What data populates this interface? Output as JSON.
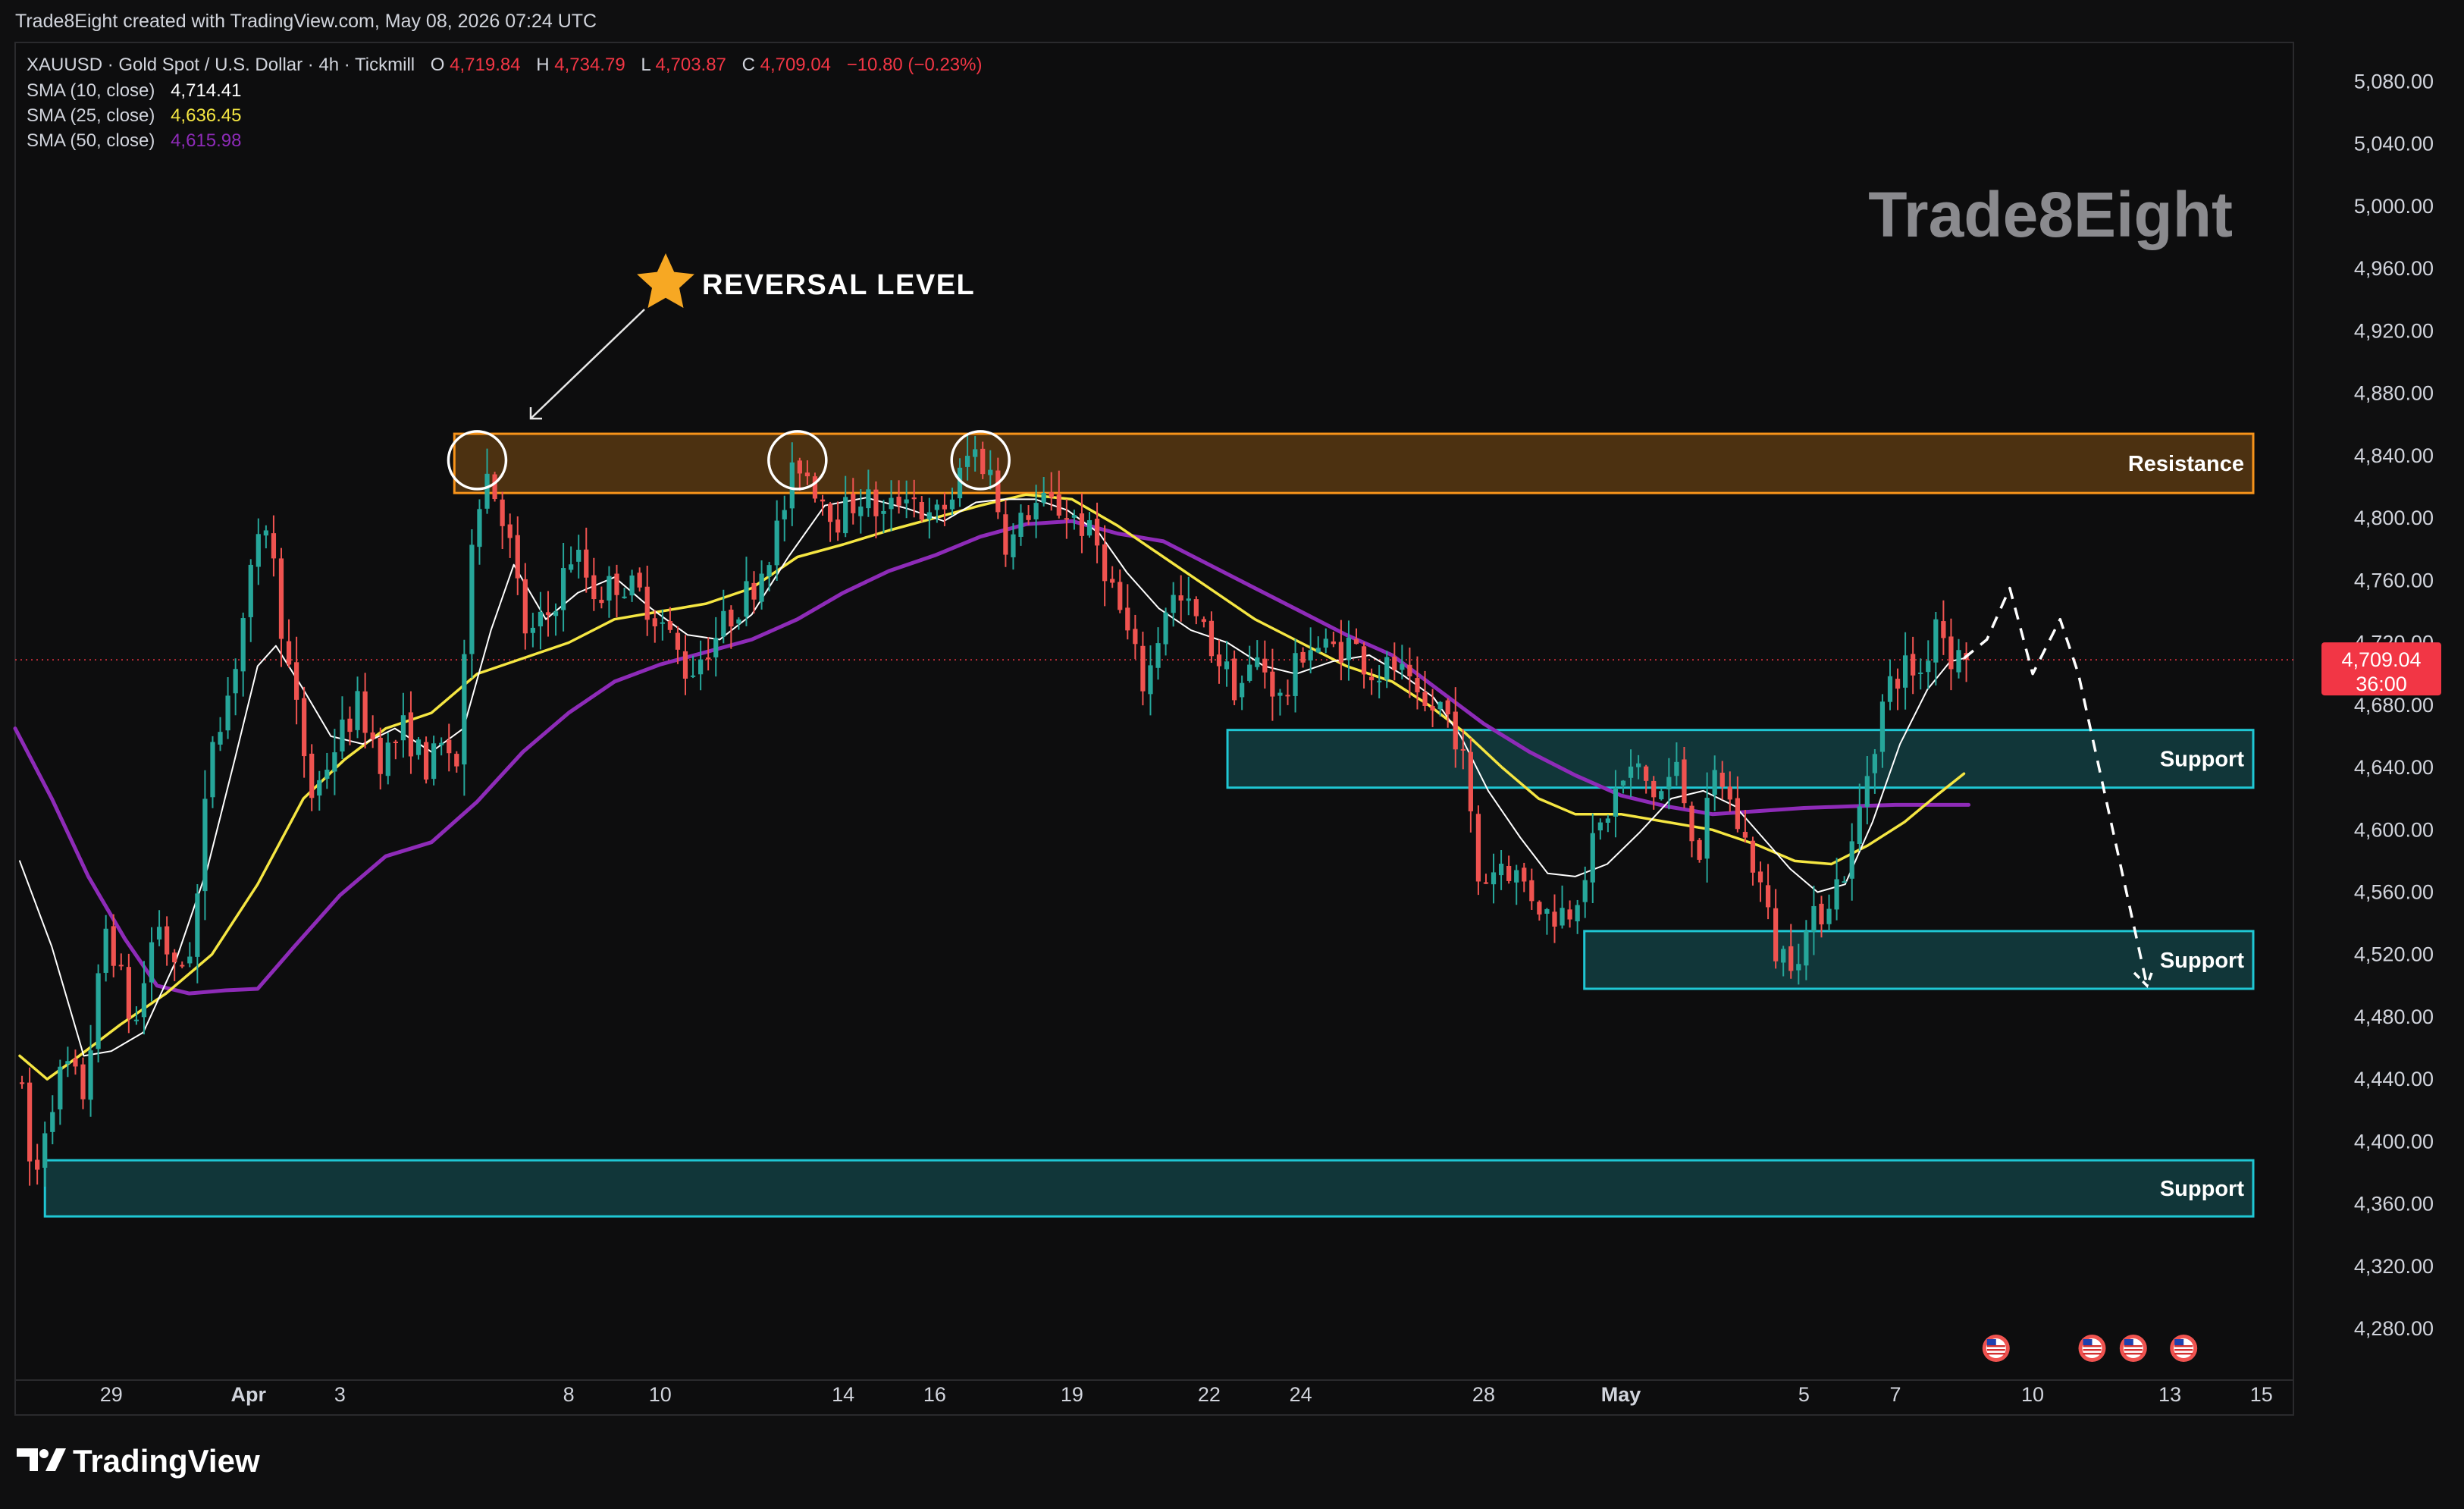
{
  "header": {
    "created_text": "Trade8Eight created with TradingView.com, May 08, 2026 07:24 UTC"
  },
  "legend": {
    "symbol_line": "XAUUSD · Gold Spot / U.S. Dollar · 4h · Tickmill",
    "ohlc": {
      "o_label": "O",
      "o_value": "4,719.84",
      "h_label": "H",
      "h_value": "4,734.79",
      "l_label": "L",
      "l_value": "4,703.87",
      "c_label": "C",
      "c_value": "4,709.04",
      "change": "−10.80 (−0.23%)"
    },
    "indicators": [
      {
        "label": "SMA (10, close)",
        "value": "4,714.41",
        "color": "#ffffff"
      },
      {
        "label": "SMA (25, close)",
        "value": "4,636.45",
        "color": "#f5e642"
      },
      {
        "label": "SMA (50, close)",
        "value": "4,615.98",
        "color": "#8e2bb8"
      }
    ]
  },
  "watermark": "Trade8Eight",
  "annotation": {
    "text": "REVERSAL LEVEL",
    "star_icon": "star-icon"
  },
  "zones": [
    {
      "label": "Resistance",
      "low": 4816,
      "high": 4854,
      "x_start": 7.5,
      "color": "#f7931a"
    },
    {
      "label": "Support",
      "low": 4627,
      "high": 4664,
      "x_start": 24.4,
      "color": "#1fc7d4"
    },
    {
      "label": "Support",
      "low": 4498,
      "high": 4535,
      "x_start": 32.2,
      "color": "#1fc7d4"
    },
    {
      "label": "Support",
      "low": 4352,
      "high": 4388,
      "x_start": -1.45,
      "color": "#1fc7d4"
    }
  ],
  "price_badge": {
    "price": "4,709.04",
    "countdown": "36:00",
    "value": 4709.04,
    "color": "#f23645"
  },
  "branding": {
    "logo_text": "TradingView"
  },
  "chart_data": {
    "type": "candlestick",
    "timeframe": "4h",
    "y_axis": {
      "ticks": [
        4280,
        4320,
        4360,
        4400,
        4440,
        4480,
        4520,
        4560,
        4600,
        4640,
        4680,
        4720,
        4760,
        4800,
        4840,
        4880,
        4920,
        4960,
        5000,
        5040,
        5080
      ],
      "tick_labels": [
        "4,280.00",
        "4,320.00",
        "4,360.00",
        "4,400.00",
        "4,440.00",
        "4,480.00",
        "4,520.00",
        "4,560.00",
        "4,600.00",
        "4,640.00",
        "4,680.00",
        "4,720.00",
        "4,760.00",
        "4,800.00",
        "4,840.00",
        "4,880.00",
        "4,920.00",
        "4,960.00",
        "5,000.00",
        "5,040.00",
        "5,080.00"
      ],
      "range": [
        4247,
        5105
      ]
    },
    "x_axis": {
      "range_days": [
        -2.1,
        47.7
      ],
      "ticks": [
        {
          "label": "29",
          "day": 0,
          "bold": false
        },
        {
          "label": "Apr",
          "day": 3,
          "bold": true
        },
        {
          "label": "3",
          "day": 5,
          "bold": false
        },
        {
          "label": "8",
          "day": 10,
          "bold": false
        },
        {
          "label": "10",
          "day": 12,
          "bold": false
        },
        {
          "label": "14",
          "day": 16,
          "bold": false
        },
        {
          "label": "16",
          "day": 18,
          "bold": false
        },
        {
          "label": "19",
          "day": 21,
          "bold": false
        },
        {
          "label": "22",
          "day": 24,
          "bold": false
        },
        {
          "label": "24",
          "day": 26,
          "bold": false
        },
        {
          "label": "28",
          "day": 30,
          "bold": false
        },
        {
          "label": "May",
          "day": 33,
          "bold": true
        },
        {
          "label": "5",
          "day": 37,
          "bold": false
        },
        {
          "label": "7",
          "day": 39,
          "bold": false
        },
        {
          "label": "10",
          "day": 42,
          "bold": false
        },
        {
          "label": "13",
          "day": 45,
          "bold": false
        },
        {
          "label": "15",
          "day": 47,
          "bold": false
        }
      ]
    },
    "candle_colors": {
      "up": "#26a69a",
      "down": "#ef5350"
    },
    "anchors": [
      [
        -2.0,
        4440
      ],
      [
        -1.7,
        4366
      ],
      [
        -1.4,
        4420
      ],
      [
        -1.0,
        4450
      ],
      [
        -0.6,
        4430
      ],
      [
        -0.1,
        4540
      ],
      [
        0.5,
        4470
      ],
      [
        1.0,
        4545
      ],
      [
        1.4,
        4505
      ],
      [
        1.8,
        4530
      ],
      [
        2.2,
        4660
      ],
      [
        2.6,
        4690
      ],
      [
        3.0,
        4755
      ],
      [
        3.4,
        4800
      ],
      [
        3.8,
        4715
      ],
      [
        4.4,
        4620
      ],
      [
        4.9,
        4655
      ],
      [
        5.4,
        4680
      ],
      [
        5.9,
        4645
      ],
      [
        6.4,
        4665
      ],
      [
        6.9,
        4640
      ],
      [
        7.3,
        4655
      ],
      [
        7.6,
        4640
      ],
      [
        7.9,
        4800
      ],
      [
        8.2,
        4830
      ],
      [
        8.6,
        4800
      ],
      [
        9.1,
        4720
      ],
      [
        9.6,
        4740
      ],
      [
        10.1,
        4780
      ],
      [
        10.6,
        4750
      ],
      [
        11.1,
        4760
      ],
      [
        11.6,
        4750
      ],
      [
        12.1,
        4730
      ],
      [
        12.6,
        4700
      ],
      [
        13.1,
        4720
      ],
      [
        13.6,
        4740
      ],
      [
        14.1,
        4760
      ],
      [
        14.6,
        4795
      ],
      [
        15.0,
        4838
      ],
      [
        15.4,
        4820
      ],
      [
        15.9,
        4800
      ],
      [
        16.4,
        4815
      ],
      [
        16.9,
        4800
      ],
      [
        17.4,
        4820
      ],
      [
        17.9,
        4796
      ],
      [
        18.4,
        4815
      ],
      [
        18.8,
        4845
      ],
      [
        19.2,
        4830
      ],
      [
        19.6,
        4780
      ],
      [
        20.1,
        4808
      ],
      [
        20.6,
        4808
      ],
      [
        21.1,
        4800
      ],
      [
        21.6,
        4780
      ],
      [
        22.1,
        4735
      ],
      [
        22.6,
        4690
      ],
      [
        23.1,
        4750
      ],
      [
        23.6,
        4740
      ],
      [
        24.1,
        4715
      ],
      [
        24.6,
        4690
      ],
      [
        25.1,
        4710
      ],
      [
        25.6,
        4680
      ],
      [
        26.1,
        4720
      ],
      [
        26.6,
        4715
      ],
      [
        27.1,
        4720
      ],
      [
        27.6,
        4700
      ],
      [
        28.1,
        4705
      ],
      [
        28.6,
        4675
      ],
      [
        29.1,
        4680
      ],
      [
        29.5,
        4655
      ],
      [
        29.9,
        4565
      ],
      [
        30.4,
        4580
      ],
      [
        30.9,
        4565
      ],
      [
        31.4,
        4545
      ],
      [
        31.9,
        4550
      ],
      [
        32.4,
        4590
      ],
      [
        32.9,
        4625
      ],
      [
        33.3,
        4640
      ],
      [
        33.8,
        4620
      ],
      [
        34.2,
        4640
      ],
      [
        34.7,
        4585
      ],
      [
        35.1,
        4640
      ],
      [
        35.6,
        4600
      ],
      [
        36.0,
        4570
      ],
      [
        36.4,
        4520
      ],
      [
        36.8,
        4520
      ],
      [
        37.2,
        4540
      ],
      [
        37.6,
        4560
      ],
      [
        38.0,
        4580
      ],
      [
        38.4,
        4640
      ],
      [
        38.8,
        4690
      ],
      [
        39.2,
        4705
      ],
      [
        39.6,
        4700
      ],
      [
        39.9,
        4740
      ],
      [
        40.2,
        4712
      ],
      [
        40.5,
        4709
      ]
    ],
    "sma10": [
      [
        -2.0,
        4580
      ],
      [
        -1.3,
        4525
      ],
      [
        -0.6,
        4455
      ],
      [
        0.0,
        4458
      ],
      [
        0.7,
        4470
      ],
      [
        1.4,
        4515
      ],
      [
        2.1,
        4575
      ],
      [
        2.7,
        4645
      ],
      [
        3.2,
        4705
      ],
      [
        3.6,
        4718
      ],
      [
        4.2,
        4690
      ],
      [
        4.8,
        4660
      ],
      [
        5.5,
        4655
      ],
      [
        6.2,
        4665
      ],
      [
        7.0,
        4650
      ],
      [
        7.7,
        4665
      ],
      [
        8.3,
        4728
      ],
      [
        8.8,
        4770
      ],
      [
        9.5,
        4735
      ],
      [
        10.2,
        4752
      ],
      [
        11.0,
        4762
      ],
      [
        11.8,
        4742
      ],
      [
        12.6,
        4725
      ],
      [
        13.3,
        4722
      ],
      [
        14.0,
        4738
      ],
      [
        14.8,
        4775
      ],
      [
        15.6,
        4808
      ],
      [
        16.5,
        4813
      ],
      [
        17.4,
        4806
      ],
      [
        18.2,
        4798
      ],
      [
        18.9,
        4810
      ],
      [
        19.5,
        4812
      ],
      [
        20.2,
        4812
      ],
      [
        20.9,
        4805
      ],
      [
        21.6,
        4790
      ],
      [
        22.2,
        4765
      ],
      [
        22.9,
        4742
      ],
      [
        23.6,
        4728
      ],
      [
        24.4,
        4720
      ],
      [
        25.2,
        4705
      ],
      [
        25.9,
        4700
      ],
      [
        26.7,
        4708
      ],
      [
        27.5,
        4712
      ],
      [
        28.2,
        4700
      ],
      [
        28.9,
        4685
      ],
      [
        29.5,
        4660
      ],
      [
        30.1,
        4625
      ],
      [
        30.8,
        4595
      ],
      [
        31.4,
        4572
      ],
      [
        32.0,
        4570
      ],
      [
        32.7,
        4578
      ],
      [
        33.4,
        4598
      ],
      [
        34.1,
        4620
      ],
      [
        34.8,
        4625
      ],
      [
        35.5,
        4615
      ],
      [
        36.1,
        4595
      ],
      [
        36.7,
        4575
      ],
      [
        37.3,
        4560
      ],
      [
        37.9,
        4565
      ],
      [
        38.5,
        4605
      ],
      [
        39.1,
        4655
      ],
      [
        39.7,
        4690
      ],
      [
        40.2,
        4708
      ],
      [
        40.5,
        4710
      ]
    ],
    "sma25": [
      [
        -2.0,
        4455
      ],
      [
        -1.4,
        4440
      ],
      [
        -0.7,
        4455
      ],
      [
        0.2,
        4475
      ],
      [
        1.2,
        4495
      ],
      [
        2.2,
        4520
      ],
      [
        3.2,
        4565
      ],
      [
        4.2,
        4620
      ],
      [
        5.1,
        4645
      ],
      [
        6.0,
        4665
      ],
      [
        7.0,
        4675
      ],
      [
        8.0,
        4700
      ],
      [
        9.0,
        4710
      ],
      [
        10.0,
        4720
      ],
      [
        11.0,
        4735
      ],
      [
        12.0,
        4740
      ],
      [
        13.0,
        4745
      ],
      [
        14.0,
        4755
      ],
      [
        15.0,
        4775
      ],
      [
        16.0,
        4783
      ],
      [
        17.0,
        4792
      ],
      [
        18.0,
        4800
      ],
      [
        19.0,
        4808
      ],
      [
        20.0,
        4815
      ],
      [
        21.0,
        4812
      ],
      [
        22.0,
        4795
      ],
      [
        23.0,
        4775
      ],
      [
        24.0,
        4755
      ],
      [
        25.0,
        4735
      ],
      [
        26.0,
        4720
      ],
      [
        27.0,
        4705
      ],
      [
        28.0,
        4695
      ],
      [
        28.8,
        4680
      ],
      [
        29.6,
        4662
      ],
      [
        30.4,
        4640
      ],
      [
        31.2,
        4620
      ],
      [
        32.0,
        4610
      ],
      [
        33.0,
        4610
      ],
      [
        34.0,
        4605
      ],
      [
        35.0,
        4600
      ],
      [
        36.0,
        4590
      ],
      [
        36.8,
        4580
      ],
      [
        37.6,
        4578
      ],
      [
        38.4,
        4590
      ],
      [
        39.2,
        4605
      ],
      [
        39.9,
        4622
      ],
      [
        40.5,
        4636
      ]
    ],
    "sma50": [
      [
        -2.1,
        4665
      ],
      [
        -1.3,
        4620
      ],
      [
        -0.5,
        4570
      ],
      [
        0.3,
        4530
      ],
      [
        1.0,
        4500
      ],
      [
        1.7,
        4495
      ],
      [
        2.5,
        4497
      ],
      [
        3.2,
        4498
      ],
      [
        4.0,
        4525
      ],
      [
        5.0,
        4558
      ],
      [
        6.0,
        4583
      ],
      [
        7.0,
        4592
      ],
      [
        8.0,
        4618
      ],
      [
        9.0,
        4650
      ],
      [
        10.0,
        4675
      ],
      [
        11.0,
        4695
      ],
      [
        12.0,
        4706
      ],
      [
        13.0,
        4714
      ],
      [
        14.0,
        4722
      ],
      [
        15.0,
        4735
      ],
      [
        16.0,
        4752
      ],
      [
        17.0,
        4766
      ],
      [
        18.0,
        4776
      ],
      [
        19.0,
        4788
      ],
      [
        20.0,
        4796
      ],
      [
        21.0,
        4798
      ],
      [
        22.0,
        4790
      ],
      [
        23.0,
        4785
      ],
      [
        24.0,
        4770
      ],
      [
        25.0,
        4755
      ],
      [
        26.0,
        4740
      ],
      [
        27.0,
        4725
      ],
      [
        28.0,
        4712
      ],
      [
        29.0,
        4690
      ],
      [
        30.0,
        4668
      ],
      [
        31.0,
        4650
      ],
      [
        32.0,
        4635
      ],
      [
        33.0,
        4622
      ],
      [
        34.0,
        4615
      ],
      [
        35.0,
        4610
      ],
      [
        36.0,
        4612
      ],
      [
        37.0,
        4614
      ],
      [
        38.0,
        4615
      ],
      [
        39.0,
        4616
      ],
      [
        40.0,
        4616
      ],
      [
        40.6,
        4616
      ]
    ],
    "projection": [
      [
        40.5,
        4710
      ],
      [
        41.0,
        4722
      ],
      [
        41.5,
        4755
      ],
      [
        42.0,
        4700
      ],
      [
        42.6,
        4735
      ],
      [
        43.0,
        4700
      ],
      [
        44.5,
        4500
      ]
    ],
    "reversal_points": [
      {
        "day": 8.0,
        "price": 4838
      },
      {
        "day": 15.0,
        "price": 4838
      },
      {
        "day": 19.0,
        "price": 4838
      }
    ],
    "event_icon_days": [
      41.2,
      43.3,
      44.2,
      45.3
    ]
  }
}
